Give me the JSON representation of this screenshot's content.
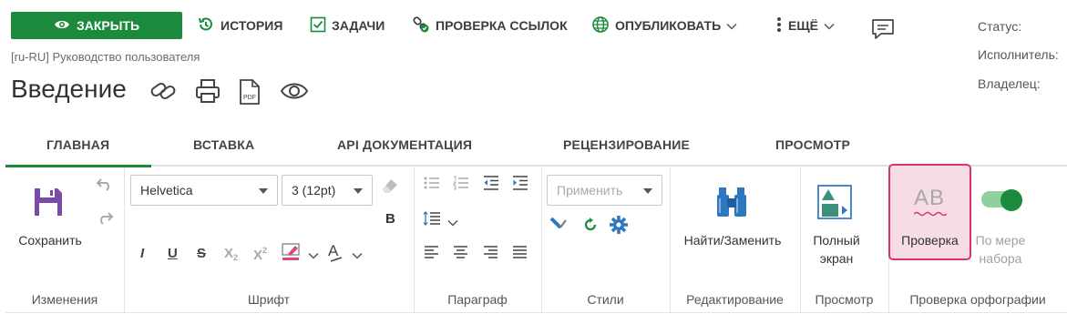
{
  "toolbar": {
    "close": "ЗАКРЫТЬ",
    "history": "ИСТОРИЯ",
    "tasks": "ЗАДАЧИ",
    "check_links": "ПРОВЕРКА ССЫЛОК",
    "publish": "ОПУБЛИКОВАТЬ",
    "more": "ЕЩЁ"
  },
  "meta": {
    "status_label": "Статус:",
    "assignee_label": "Исполнитель:",
    "owner_label": "Владелец:"
  },
  "document": {
    "breadcrumb": "[ru-RU] Руководство пользователя",
    "title": "Введение"
  },
  "tabs": [
    "ГЛАВНАЯ",
    "ВСТАВКА",
    "API ДОКУМЕНТАЦИЯ",
    "РЕЦЕНЗИРОВАНИЕ",
    "ПРОСМОТР"
  ],
  "active_tab": "ГЛАВНАЯ",
  "ribbon": {
    "changes": {
      "save": "Сохранить",
      "group": "Изменения"
    },
    "font": {
      "family": "Helvetica",
      "size": "3 (12pt)",
      "bold": "B",
      "italic": "I",
      "underline": "U",
      "strike": "S",
      "subscript": "X",
      "sub_mark": "2",
      "superscript": "X",
      "sup_mark": "2",
      "font_color": "A",
      "group": "Шрифт"
    },
    "paragraph": {
      "group": "Параграф"
    },
    "styles": {
      "placeholder": "Применить",
      "group": "Стили"
    },
    "editing": {
      "find_replace": "Найти/Заменить",
      "group": "Редактирование"
    },
    "view": {
      "fullscreen_line1": "Полный",
      "fullscreen_line2": "экран",
      "group": "Просмотр"
    },
    "spelling": {
      "check": "Проверка",
      "check_icon_text": "AB",
      "as_you_type_line1": "По мере",
      "as_you_type_line2": "набора",
      "as_you_type_on": true,
      "group": "Проверка орфографии"
    }
  },
  "colors": {
    "accent": "#1c8a3c",
    "spell_border": "#d8336f",
    "spell_bg": "#f6dce6",
    "purple_save": "#7b4aa8",
    "blue_icon": "#2e78c2"
  }
}
